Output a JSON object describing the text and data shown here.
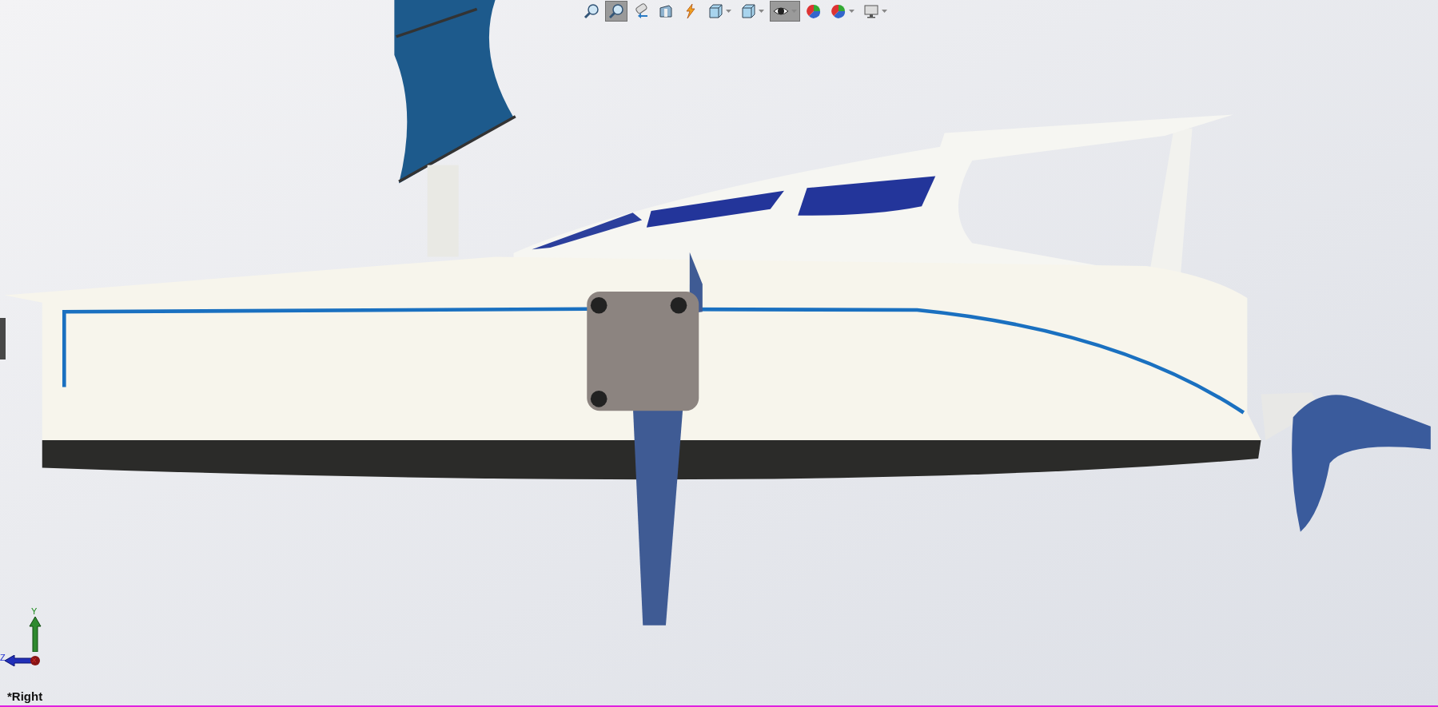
{
  "toolbar": [
    {
      "kind": "zoom-fit",
      "selected": false,
      "dropdown": false
    },
    {
      "kind": "zoom-area",
      "selected": true,
      "dropdown": false
    },
    {
      "kind": "previous-view",
      "selected": false,
      "dropdown": false
    },
    {
      "kind": "section",
      "selected": false,
      "dropdown": false
    },
    {
      "kind": "annotation",
      "selected": false,
      "dropdown": false
    },
    {
      "kind": "orientation",
      "selected": false,
      "dropdown": true
    },
    {
      "kind": "display-style",
      "selected": false,
      "dropdown": true
    },
    {
      "kind": "hide-show",
      "selected": true,
      "dropdown": true
    },
    {
      "kind": "appearance",
      "selected": false,
      "dropdown": false
    },
    {
      "kind": "scene",
      "selected": false,
      "dropdown": true
    },
    {
      "kind": "view-settings",
      "selected": false,
      "dropdown": true
    }
  ],
  "triad": {
    "y_label": "Y",
    "z_label": "Z",
    "x_label": "X"
  },
  "view_name": "*Right"
}
